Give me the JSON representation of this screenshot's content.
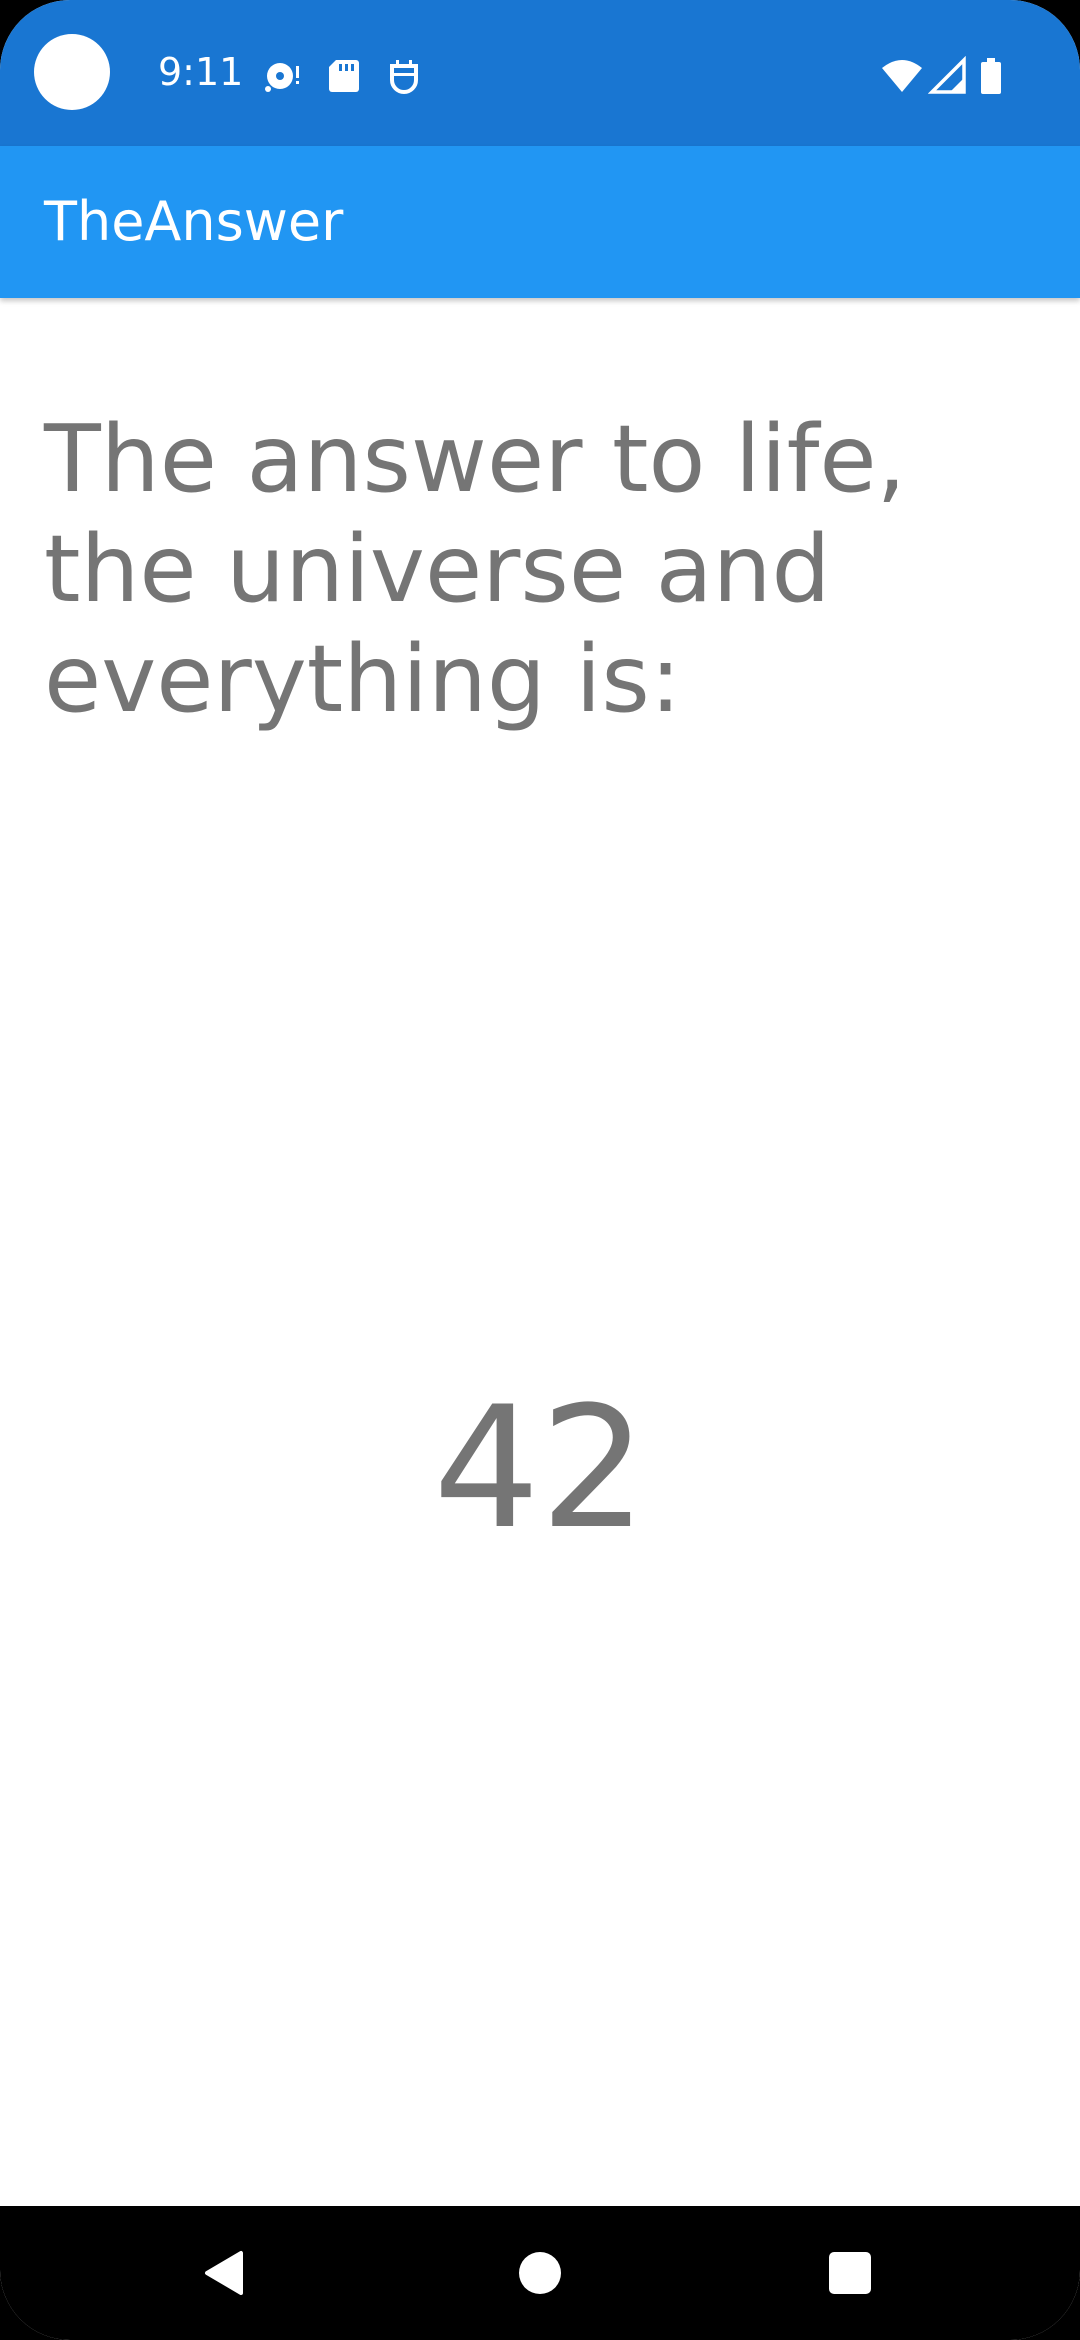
{
  "status_bar": {
    "time": "9:11",
    "icons": [
      "camera-cutout",
      "media-icon",
      "sd-card-icon",
      "android-debug-icon",
      "wifi-icon",
      "signal-icon",
      "battery-icon"
    ],
    "color": "#1976D2"
  },
  "app_bar": {
    "title": "TheAnswer",
    "color": "#2196F3"
  },
  "content": {
    "question": "The answer to life, the universe and everything is:",
    "answer": "42",
    "text_color": "#757575"
  },
  "nav_bar": {
    "buttons": [
      "back-icon",
      "home-icon",
      "recents-icon"
    ]
  }
}
